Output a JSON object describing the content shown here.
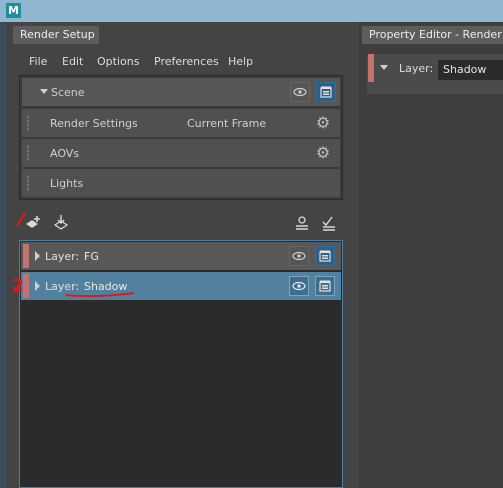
{
  "app": {
    "logo_letter": "M"
  },
  "render_setup": {
    "tab_title": "Render Setup",
    "menu": [
      "File",
      "Edit",
      "Options",
      "Preferences",
      "Help"
    ],
    "scene": {
      "label": "Scene",
      "rows": [
        {
          "label": "Render Settings",
          "value": "Current Frame"
        },
        {
          "label": "AOVs"
        },
        {
          "label": "Lights"
        }
      ]
    },
    "layers": [
      {
        "prefix": "Layer:",
        "name": "FG",
        "selected": false
      },
      {
        "prefix": "Layer:",
        "name": "Shadow",
        "selected": true
      }
    ]
  },
  "property_editor": {
    "tab_title": "Property Editor - Render Se",
    "layer_prefix": "Layer:",
    "layer_name": "Shadow"
  },
  "annotations": {
    "number_label": "2"
  },
  "colors": {
    "accent_selected": "#52809f",
    "layer_color_bar": "#c3726d",
    "annotation_red": "#e01818"
  }
}
